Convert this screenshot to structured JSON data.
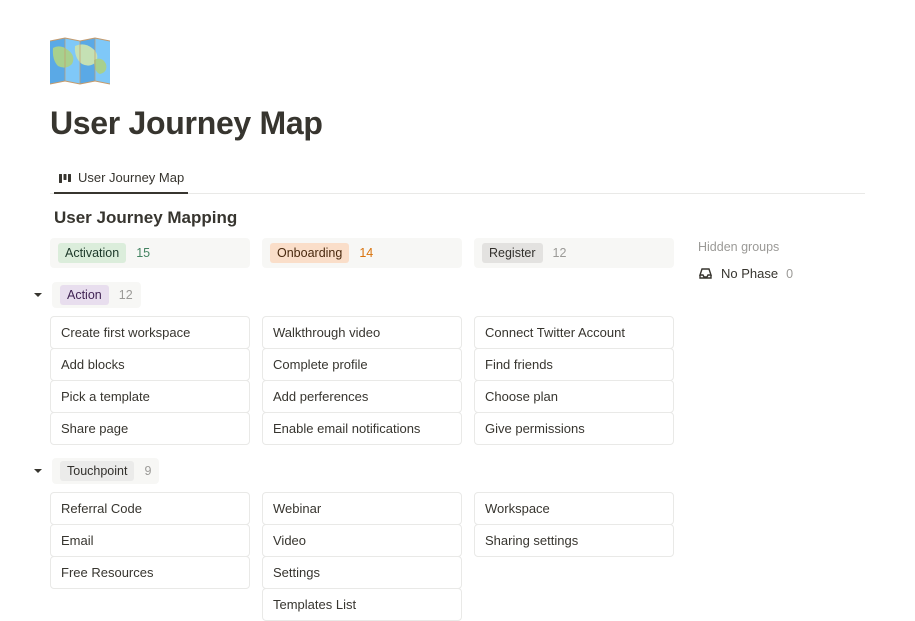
{
  "page": {
    "title": "User Journey Map",
    "tab_label": "User Journey Map",
    "subtitle": "User Journey Mapping"
  },
  "columns": [
    {
      "label": "Activation",
      "pillClass": "pill-green",
      "count": 15,
      "countClass": "count-green"
    },
    {
      "label": "Onboarding",
      "pillClass": "pill-orange",
      "count": 14,
      "countClass": "count-orange"
    },
    {
      "label": "Register",
      "pillClass": "pill-gray",
      "count": 12,
      "countClass": "count-gray"
    }
  ],
  "groups": [
    {
      "label": "Action",
      "pillClass": "pill-purple",
      "count": 12,
      "rows": [
        [
          "Create first workspace",
          "Walkthrough video",
          "Connect Twitter Account"
        ],
        [
          "Add blocks",
          "Complete profile",
          "Find friends"
        ],
        [
          "Pick a template",
          "Add perferences",
          "Choose plan"
        ],
        [
          "Share page",
          "Enable email notifications",
          "Give permissions"
        ]
      ]
    },
    {
      "label": "Touchpoint",
      "pillClass": "pill-lgray",
      "count": 9,
      "rows": [
        [
          "Referral Code",
          "Webinar",
          "Workspace"
        ],
        [
          "Email",
          "Video",
          "Sharing settings"
        ],
        [
          "Free Resources",
          "Settings",
          null
        ],
        [
          null,
          "Templates List",
          null
        ]
      ]
    }
  ],
  "sidepanel": {
    "hidden_label": "Hidden groups",
    "no_phase_label": "No Phase",
    "no_phase_count": 0
  }
}
